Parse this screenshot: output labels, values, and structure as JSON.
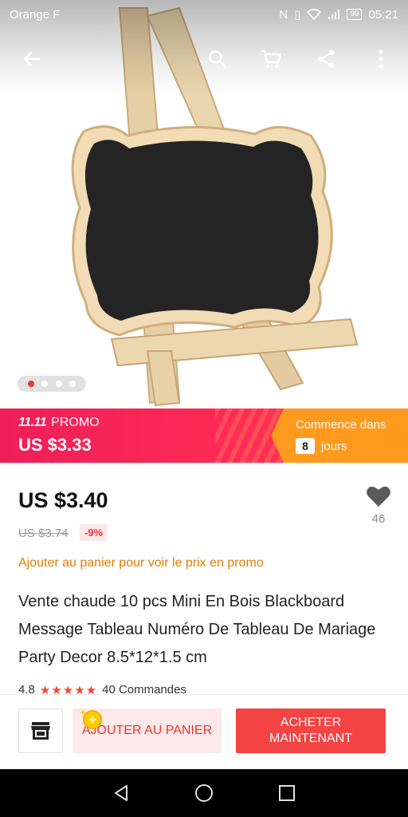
{
  "status_bar": {
    "carrier": "Orange F",
    "battery": "99",
    "time": "05:21",
    "icons": [
      "nfc-icon",
      "vibrate-icon",
      "wifi-icon",
      "signal-icon",
      "battery-icon"
    ]
  },
  "toolbar": {
    "icons": [
      "back-arrow-icon",
      "search-icon",
      "cart-icon",
      "share-icon",
      "more-vert-icon"
    ]
  },
  "product_image": {
    "alt": "Wooden mini easel with chalkboard sign",
    "slides_total": 4,
    "active_slide": 1
  },
  "promo": {
    "event": "11.11",
    "label": "PROMO",
    "price": "US $3.33",
    "starts_label": "Commence dans",
    "days": "8",
    "days_label": "jours"
  },
  "product": {
    "price": "US $3.40",
    "old_price": "US $3.74",
    "discount": "-9%",
    "wishlist_count": "46",
    "cart_hint": "Ajouter au panier pour voir le prix en promo",
    "title": "Vente chaude 10 pcs Mini En Bois Blackboard Message Tableau Numéro De Tableau De Mariage Party Decor 8.5*12*1.5 cm",
    "rating": "4.8",
    "stars": "★★★★★",
    "orders": "40 Commandes"
  },
  "actions": {
    "add_to_cart": "AJOUTER AU PANIER",
    "buy_now_line1": "ACHETER",
    "buy_now_line2": "MAINTENANT"
  },
  "colors": {
    "accent_red": "#f44343",
    "promo_pink": "#ee1e58",
    "promo_orange": "#ff9a1f",
    "hint_orange": "#e67e00"
  }
}
